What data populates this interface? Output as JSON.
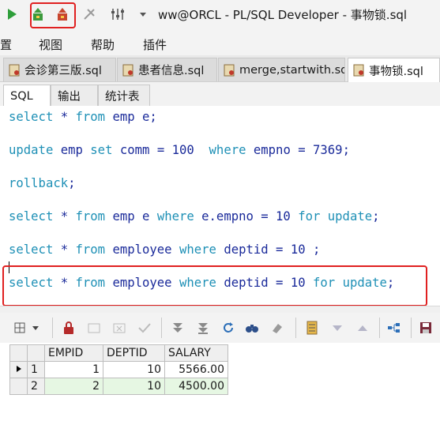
{
  "window": {
    "title": "ww@ORCL - PL/SQL Developer - 事物锁.sql"
  },
  "menu": {
    "items": [
      "置",
      "视图",
      "帮助",
      "插件"
    ]
  },
  "doc_tabs": [
    {
      "label": "会诊第三版.sql"
    },
    {
      "label": "患者信息.sql"
    },
    {
      "label": "merge,startwith.sql"
    },
    {
      "label": "事物锁.sql"
    }
  ],
  "sql_tabs": [
    "SQL",
    "输出",
    "统计表"
  ],
  "editor": {
    "lines": [
      "select * from emp e;",
      "update emp set comm = 100  where empno = 7369;",
      "rollback;",
      "select * from emp e where e.empno = 10 for update;",
      "select * from employee where deptid = 10 ;",
      "select * from employee where deptid = 10 for update;"
    ]
  },
  "grid": {
    "columns": [
      "EMPID",
      "DEPTID",
      "SALARY"
    ],
    "rows": [
      {
        "num": "1",
        "empid": "1",
        "deptid": "10",
        "salary": "5566.00"
      },
      {
        "num": "2",
        "empid": "2",
        "deptid": "10",
        "salary": "4500.00"
      }
    ]
  },
  "colors": {
    "highlight": "#e02020",
    "keyword": "#1e90b6",
    "identifier": "#1a2a9a",
    "selected_row": "#e6f7e3"
  }
}
